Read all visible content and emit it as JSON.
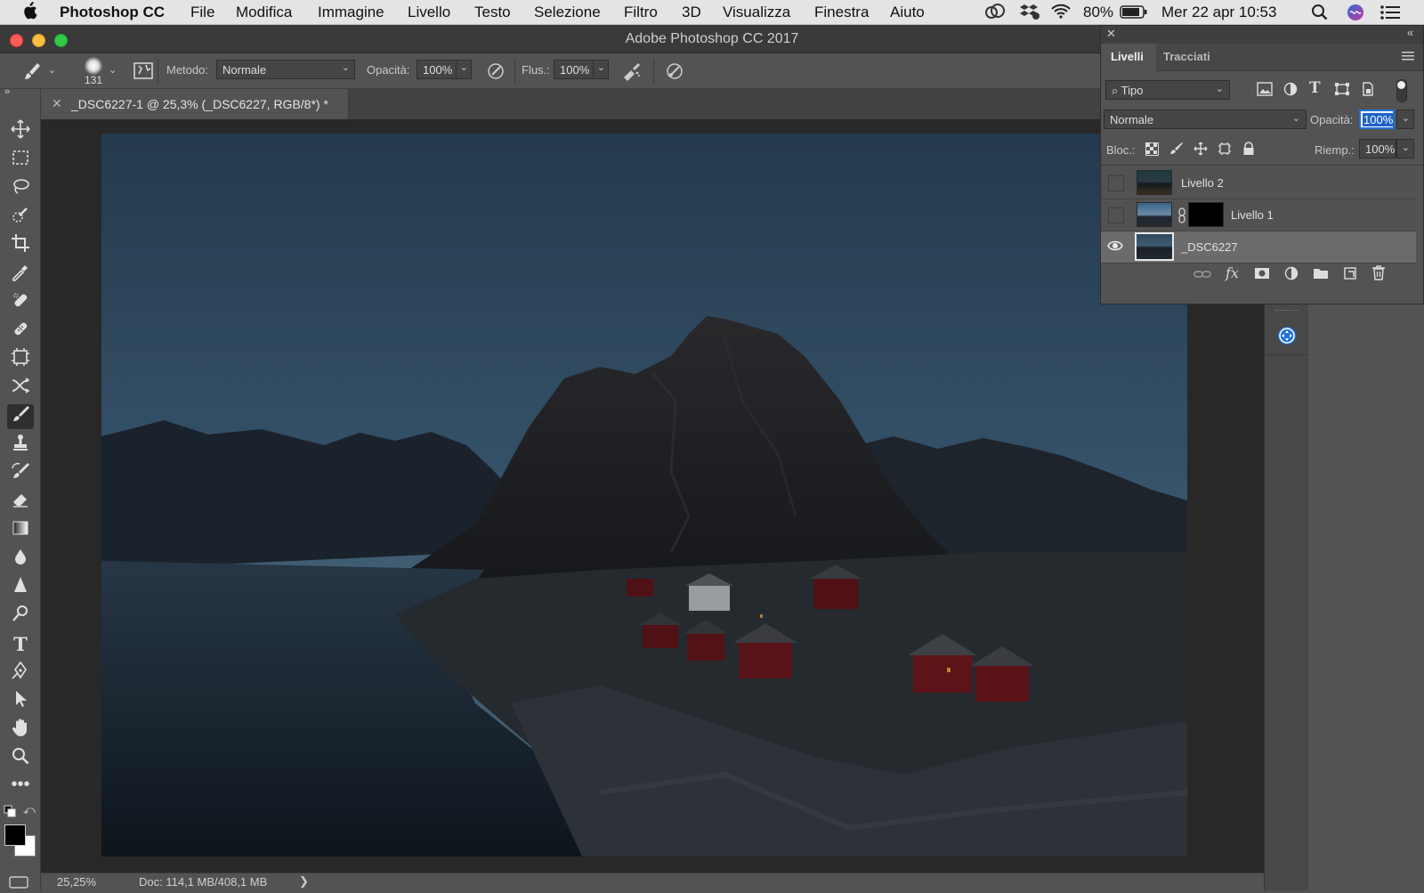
{
  "menubar": {
    "apple_icon": "apple-icon",
    "app_name": "Photoshop CC",
    "menus": [
      "File",
      "Modifica",
      "Immagine",
      "Livello",
      "Testo",
      "Selezione",
      "Filtro",
      "3D",
      "Visualizza",
      "Finestra",
      "Aiuto"
    ],
    "battery": "80%",
    "datetime": "Mer 22 apr  10:53"
  },
  "window": {
    "title": "Adobe Photoshop CC 2017"
  },
  "options": {
    "brush_size": "131",
    "metodo_label": "Metodo:",
    "metodo_value": "Normale",
    "opacita_label": "Opacità:",
    "opacita_value": "100%",
    "flusso_label": "Flus.:",
    "flusso_value": "100%"
  },
  "document": {
    "tab_title": "_DSC6227-1 @ 25,3% (_DSC6227, RGB/8*) *",
    "zoom": "25,25%",
    "doc_info": "Doc: 114,1 MB/408,1 MB"
  },
  "layers_panel": {
    "tabs": [
      "Livelli",
      "Tracciati"
    ],
    "filter_value": "Tipo",
    "blend_mode": "Normale",
    "opacity_label": "Opacità:",
    "opacity_value": "100%",
    "lock_label": "Bloc.:",
    "fill_label": "Riemp.:",
    "fill_value": "100%",
    "layers": [
      {
        "name": "Livello 2",
        "visible": false
      },
      {
        "name": "Livello 1",
        "visible": false
      },
      {
        "name": "_DSC6227",
        "visible": true
      }
    ]
  },
  "colors": {
    "ui_dark": "#535353",
    "canvas_bg": "#282828",
    "accent": "#1e73d2"
  }
}
